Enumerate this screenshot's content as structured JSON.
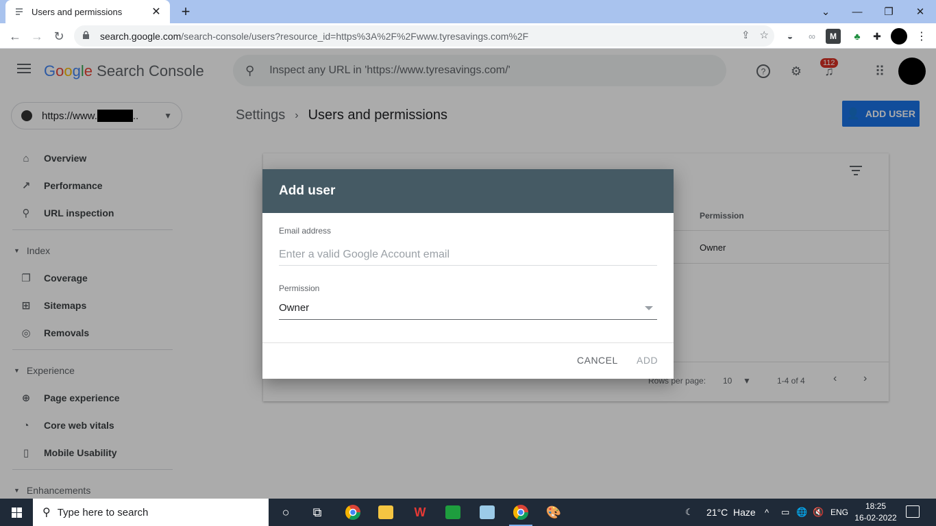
{
  "browser": {
    "tab_title": "Users and permissions",
    "tab_close": "✕",
    "new_tab": "+",
    "url_host": "search.google.com",
    "url_path": "/search-console/users?resource_id=https%3A%2F%2Fwww.tyresavings.com%2F"
  },
  "app": {
    "product_google": [
      "G",
      "o",
      "o",
      "g",
      "l",
      "e"
    ],
    "product_name": "Search Console",
    "inspect_placeholder": "Inspect any URL in 'https://www.tyresavings.com/'",
    "notification_count": "112",
    "property_prefix": "https://www.",
    "property_suffix": ".."
  },
  "sidebar": {
    "items_top": [
      {
        "label": "Overview",
        "icon": "home-icon",
        "glyph": "⌂"
      },
      {
        "label": "Performance",
        "icon": "trending-icon",
        "glyph": "↗"
      },
      {
        "label": "URL inspection",
        "icon": "search-icon",
        "glyph": "⚲"
      }
    ],
    "index_label": "Index",
    "index_items": [
      {
        "label": "Coverage",
        "icon": "pages-icon",
        "glyph": "❐"
      },
      {
        "label": "Sitemaps",
        "icon": "sitemap-icon",
        "glyph": "⊞"
      },
      {
        "label": "Removals",
        "icon": "eye-off-icon",
        "glyph": "◎"
      }
    ],
    "experience_label": "Experience",
    "experience_items": [
      {
        "label": "Page experience",
        "icon": "plus-circle-icon",
        "glyph": "⊕"
      },
      {
        "label": "Core web vitals",
        "icon": "gauge-icon",
        "glyph": "◔"
      },
      {
        "label": "Mobile Usability",
        "icon": "phone-icon",
        "glyph": "▯"
      }
    ],
    "enhancements_label": "Enhancements"
  },
  "main": {
    "breadcrumb_parent": "Settings",
    "breadcrumb_sep": "›",
    "breadcrumb_current": "Users and permissions",
    "add_user_label": "ADD USER",
    "table": {
      "permission_header": "Permission",
      "row_permission": "Owner",
      "rows_per_page_label": "Rows per page:",
      "rows_per_page_value": "10",
      "range": "1-4 of 4"
    }
  },
  "dialog": {
    "title": "Add user",
    "email_label": "Email address",
    "email_placeholder": "Enter a valid Google Account email",
    "permission_label": "Permission",
    "permission_value": "Owner",
    "cancel_label": "CANCEL",
    "add_label": "ADD"
  },
  "taskbar": {
    "search_placeholder": "Type here to search",
    "temperature": "21°C",
    "weather": "Haze",
    "language": "ENG",
    "time": "18:25",
    "date": "16-02-2022"
  },
  "colors": {
    "accent": "#1a73e8",
    "dialog_header": "#455a64",
    "badge": "#d93025",
    "taskbar": "#1f2a38"
  }
}
